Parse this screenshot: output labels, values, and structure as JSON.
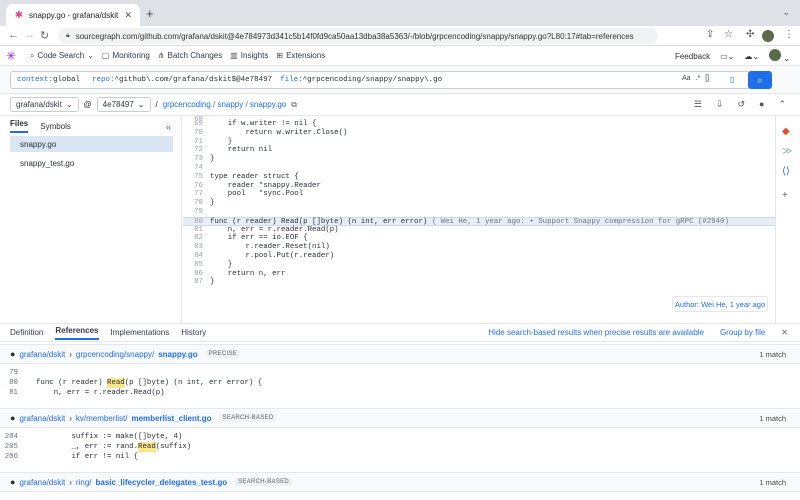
{
  "browser": {
    "tab_title": "snappy.go - grafana/dskit - So",
    "url": "sourcegraph.com/github.com/grafana/dskit@4e784973d341c5b14f0fd9ca50aa13dba38a5363/-/blob/grpcencoding/snappy/snappy.go?L80:17#tab=references"
  },
  "nav": {
    "items": [
      "Code Search",
      "Monitoring",
      "Batch Changes",
      "Insights",
      "Extensions"
    ],
    "feedback": "Feedback"
  },
  "search": {
    "context_kw": "context:",
    "context_val": "global",
    "repo_kw": "repo:",
    "repo_val": "^github\\.com/grafana/dskit$@4e78497",
    "file_kw": "file:",
    "file_val": "^grpcencoding/snappy/snappy\\.go",
    "opt_case": "Aa",
    "opt_regex": ".*",
    "opt_struct": "[]"
  },
  "breadcrumb": {
    "repo": "grafana/dskit",
    "at": "@",
    "rev": "4e78497",
    "sep": "/",
    "path": "grpcencoding / snappy / snappy.go"
  },
  "sidebar": {
    "tabs": [
      "Files",
      "Symbols"
    ],
    "files": [
      "snappy.go",
      "snappy_test.go"
    ]
  },
  "code": {
    "lines": [
      {
        "n": "68",
        "t": ""
      },
      {
        "n": "69",
        "t": "    if w.writer != nil {"
      },
      {
        "n": "70",
        "t": "        return w.writer.Close()"
      },
      {
        "n": "71",
        "t": "    }"
      },
      {
        "n": "72",
        "t": "    return nil"
      },
      {
        "n": "73",
        "t": "}"
      },
      {
        "n": "74",
        "t": ""
      },
      {
        "n": "75",
        "t": "type reader struct {"
      },
      {
        "n": "76",
        "t": "    reader *snappy.Reader"
      },
      {
        "n": "77",
        "t": "    pool   *sync.Pool"
      },
      {
        "n": "78",
        "t": "}"
      },
      {
        "n": "79",
        "t": ""
      },
      {
        "n": "80",
        "t": "func (r reader) Read(p []byte) (n int, err error)"
      },
      {
        "n": "81",
        "t": "    n, err = r.reader.Read(p)"
      },
      {
        "n": "82",
        "t": "    if err == io.EOF {"
      },
      {
        "n": "83",
        "t": "        r.reader.Reset(nil)"
      },
      {
        "n": "84",
        "t": "        r.pool.Put(r.reader)"
      },
      {
        "n": "85",
        "t": "    }"
      },
      {
        "n": "86",
        "t": "    return n, err"
      },
      {
        "n": "87",
        "t": "}"
      }
    ],
    "blame": " { Wei He, 1 year ago: • Support Snappy compression for gRPC (#2940)",
    "author_tip": "Author: Wei He, 1 year ago"
  },
  "panel": {
    "tabs": [
      "Definition",
      "References",
      "Implementations",
      "History"
    ],
    "hide_link": "Hide search-based results when precise results are available",
    "group_by": "Group by file",
    "groups": [
      {
        "repo": "grafana/dskit",
        "path": "grpcencoding/snappy/",
        "file": "snappy.go",
        "badge": "PRECISE",
        "count": "1 match",
        "lines": [
          {
            "n": "79",
            "pre": "",
            "mark": "",
            "post": ""
          },
          {
            "n": "80",
            "pre": "func (r reader) ",
            "mark": "Read",
            "post": "(p []byte) (n int, err error) {"
          },
          {
            "n": "81",
            "pre": "    n, err = r.reader.Read(p)",
            "mark": "",
            "post": ""
          }
        ]
      },
      {
        "repo": "grafana/dskit",
        "path": "kv/memberlist/",
        "file": "memberlist_client.go",
        "badge": "SEARCH-BASED",
        "count": "1 match",
        "lines": [
          {
            "n": "204",
            "pre": "        suffix := make([]byte, 4)",
            "mark": "",
            "post": ""
          },
          {
            "n": "205",
            "pre": "        _, err := rand.",
            "mark": "Read",
            "post": "(suffix)"
          },
          {
            "n": "206",
            "pre": "        if err != nil {",
            "mark": "",
            "post": ""
          }
        ]
      },
      {
        "repo": "grafana/dskit",
        "path": "ring/",
        "file": "basic_lifecycler_delegates_test.go",
        "badge": "SEARCH-BASED",
        "count": "1 match",
        "lines": []
      }
    ]
  }
}
